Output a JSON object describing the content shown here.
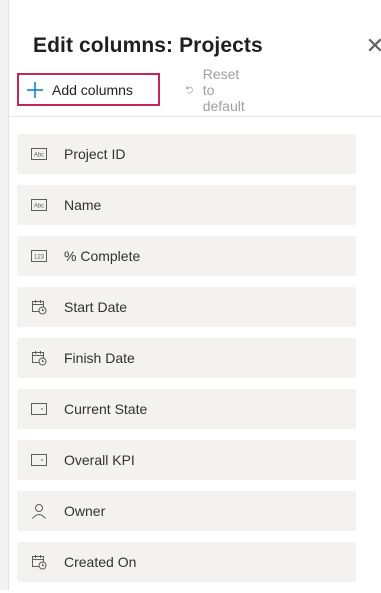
{
  "panel": {
    "title": "Edit columns: Projects",
    "close_icon": "close-icon"
  },
  "toolbar": {
    "add_label": "Add columns",
    "reset_label": "Reset to default"
  },
  "colors": {
    "highlight_border": "#c4265c",
    "accent": "#0078d4",
    "item_background": "#f3f2f1",
    "disabled_text": "#a19f9d"
  },
  "columns": [
    {
      "label": "Project ID",
      "icon": "text-type-icon"
    },
    {
      "label": "Name",
      "icon": "text-type-icon"
    },
    {
      "label": "% Complete",
      "icon": "number-type-icon"
    },
    {
      "label": "Start Date",
      "icon": "calendar-clock-icon"
    },
    {
      "label": "Finish Date",
      "icon": "calendar-clock-icon"
    },
    {
      "label": "Current State",
      "icon": "choice-type-icon"
    },
    {
      "label": "Overall KPI",
      "icon": "choice-type-icon"
    },
    {
      "label": "Owner",
      "icon": "person-icon"
    },
    {
      "label": "Created On",
      "icon": "calendar-clock-icon"
    }
  ]
}
